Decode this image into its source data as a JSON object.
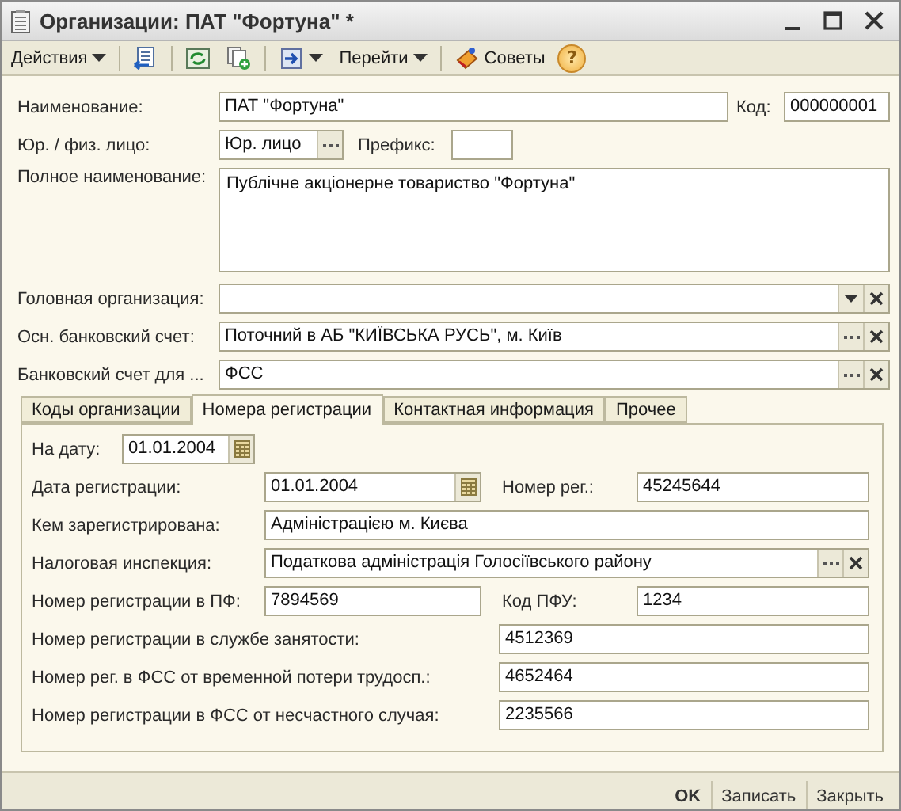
{
  "window": {
    "title": "Организации: ПАТ \"Фортуна\" *"
  },
  "toolbar": {
    "actions": "Действия",
    "goto": "Перейти",
    "tips": "Советы",
    "help": "?"
  },
  "form": {
    "name": {
      "label": "Наименование:",
      "value": "ПАТ \"Фортуна\""
    },
    "code": {
      "label": "Код:",
      "value": "000000001"
    },
    "entity_type": {
      "label": "Юр. / физ. лицо:",
      "value": "Юр. лицо"
    },
    "prefix": {
      "label": "Префикс:"
    },
    "full_name": {
      "label": "Полное наименование:",
      "value": "Публічне акціонерне товариство \"Фортуна\""
    },
    "parent_org": {
      "label": "Головная организация:"
    },
    "main_account": {
      "label": "Осн. банковский счет:",
      "value": "Поточний в АБ \"КИЇВСЬКА РУСЬ\", м. Київ"
    },
    "account_for": {
      "label": "Банковский счет для ...",
      "value": "ФСС"
    }
  },
  "tabs": [
    {
      "label": "Коды организации",
      "selected": false
    },
    {
      "label": "Номера регистрации",
      "selected": true
    },
    {
      "label": "Контактная информация",
      "selected": false
    },
    {
      "label": "Прочее",
      "selected": false
    }
  ],
  "registration": {
    "as_of": {
      "label": "На дату:",
      "value": "01.01.2004"
    },
    "reg_date": {
      "label": "Дата регистрации:",
      "value": "01.01.2004"
    },
    "reg_number": {
      "label": "Номер рег.:",
      "value": "45245644"
    },
    "registered_by": {
      "label": "Кем зарегистрирована:",
      "value": "Адміністрацією м. Києва"
    },
    "tax_office": {
      "label": "Налоговая инспекция:",
      "value": "Податкова адміністрація Голосіївського району"
    },
    "pf_number": {
      "label": "Номер регистрации в ПФ:",
      "value": "7894569"
    },
    "pfu_code": {
      "label": "Код ПФУ:",
      "value": "1234"
    },
    "employment_number": {
      "label": "Номер регистрации в службе занятости:",
      "value": "4512369"
    },
    "fss_temp_number": {
      "label": "Номер рег. в ФСС от временной потери трудосп.:",
      "value": "4652464"
    },
    "fss_accident_number": {
      "label": "Номер регистрации в ФСС от несчастного случая:",
      "value": "2235566"
    }
  },
  "buttons": [
    {
      "label": "OK",
      "kind": "default"
    },
    {
      "label": "Записать",
      "kind": "normal"
    },
    {
      "label": "Закрыть",
      "kind": "normal"
    }
  ]
}
